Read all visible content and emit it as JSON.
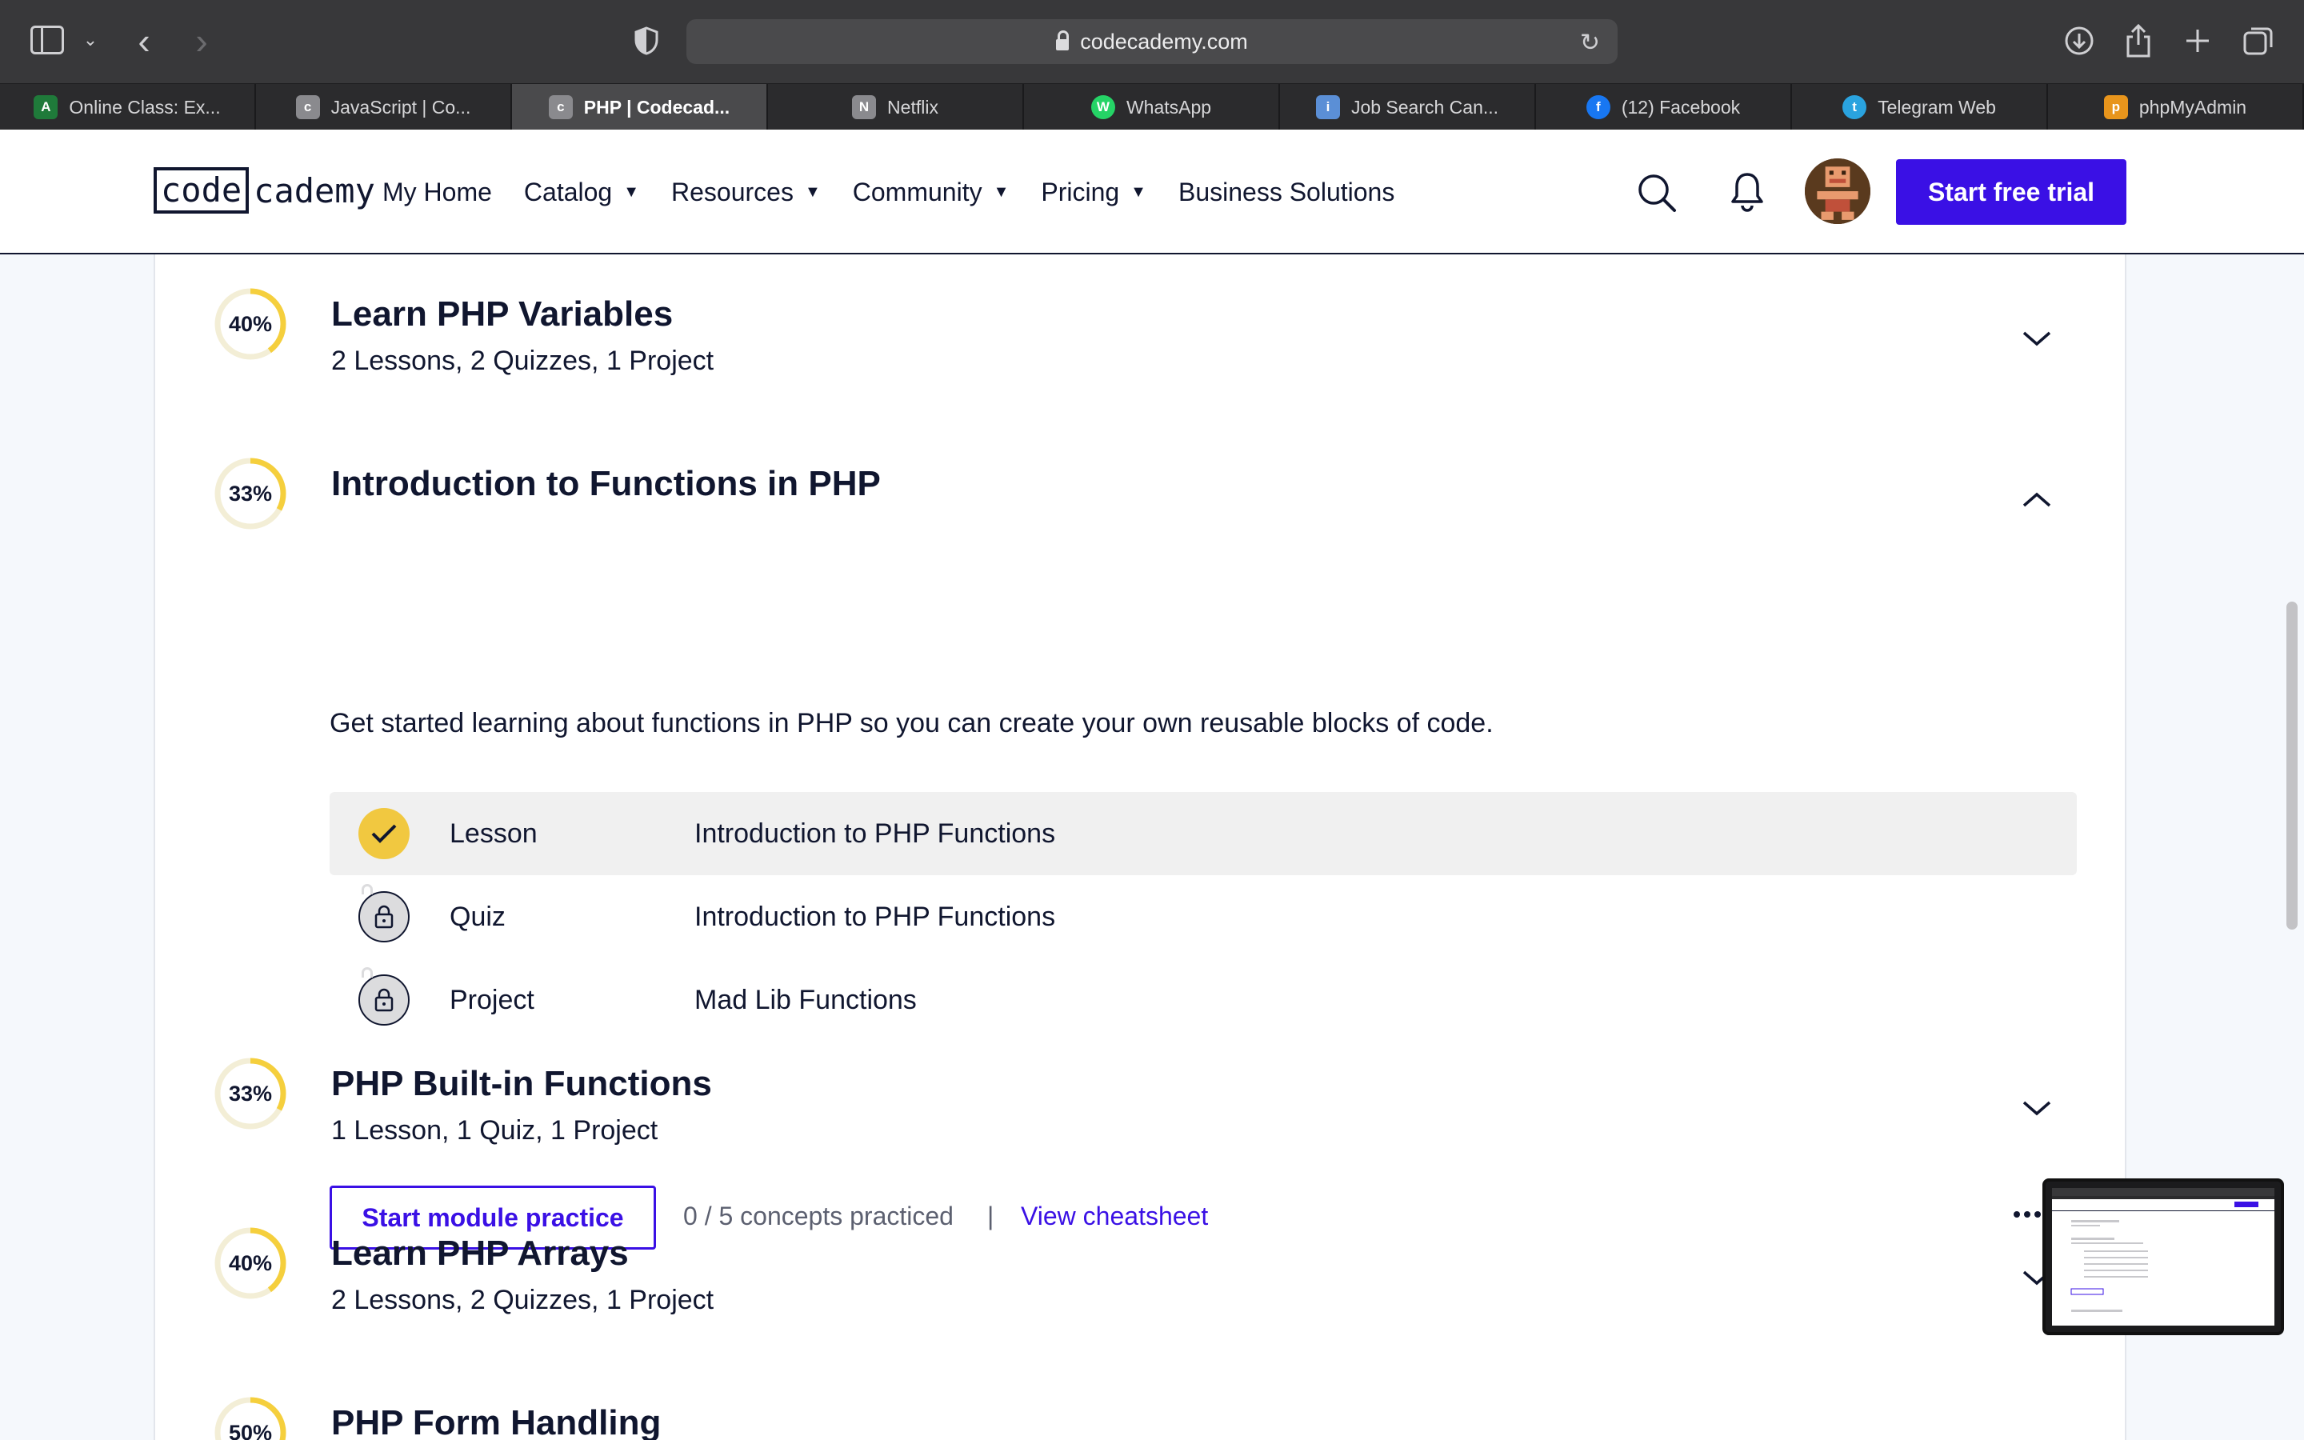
{
  "browser": {
    "url": "codecademy.com",
    "tabs": [
      {
        "title": "Online Class: Ex...",
        "favicon": "A",
        "color": "#1f7a3a",
        "active": false
      },
      {
        "title": "JavaScript | Co...",
        "favicon": "c",
        "color": "#8a8a8e",
        "active": false
      },
      {
        "title": "PHP | Codecad...",
        "favicon": "c",
        "color": "#8a8a8e",
        "active": true
      },
      {
        "title": "Netflix",
        "favicon": "N",
        "color": "#8a8a8e",
        "active": false
      },
      {
        "title": "WhatsApp",
        "favicon": "W",
        "color": "#25d366",
        "active": false
      },
      {
        "title": "Job Search Can...",
        "favicon": "i",
        "color": "#5b8fd6",
        "active": false
      },
      {
        "title": "(12) Facebook",
        "favicon": "f",
        "color": "#1877f2",
        "active": false
      },
      {
        "title": "Telegram Web",
        "favicon": "t",
        "color": "#2aa3df",
        "active": false
      },
      {
        "title": "phpMyAdmin",
        "favicon": "p",
        "color": "#e8951c",
        "active": false
      }
    ]
  },
  "header": {
    "logo_code": "code",
    "logo_cademy": "cademy",
    "nav": {
      "my_home": "My Home",
      "catalog": "Catalog",
      "resources": "Resources",
      "community": "Community",
      "pricing": "Pricing",
      "business": "Business Solutions"
    },
    "cta": "Start free trial",
    "accent_color": "#3a10e5"
  },
  "modules": [
    {
      "percent": "40%",
      "progress": 0.4,
      "title": "Learn PHP Variables",
      "subtitle": "2 Lessons, 2 Quizzes, 1 Project",
      "expanded": false
    },
    {
      "percent": "33%",
      "progress": 0.33,
      "title": "Introduction to Functions in PHP",
      "expanded": true,
      "description": "Get started learning about functions in PHP so you can create your own reusable blocks of code.",
      "items": [
        {
          "type": "Lesson",
          "name": "Introduction to PHP Functions",
          "status": "completed"
        },
        {
          "type": "Quiz",
          "name": "Introduction to PHP Functions",
          "status": "locked"
        },
        {
          "type": "Project",
          "name": "Mad Lib Functions",
          "status": "locked"
        }
      ],
      "practice_label": "Start module practice",
      "concepts_text": "0 / 5 concepts practiced",
      "separator": "|",
      "cheatsheet_label": "View cheatsheet"
    },
    {
      "percent": "33%",
      "progress": 0.33,
      "title": "PHP Built-in Functions",
      "subtitle": "1 Lesson, 1 Quiz, 1 Project",
      "expanded": false
    },
    {
      "percent": "40%",
      "progress": 0.4,
      "title": "Learn PHP Arrays",
      "subtitle": "2 Lessons, 2 Quizzes, 1 Project",
      "expanded": false
    },
    {
      "percent": "50%",
      "progress": 0.5,
      "title": "PHP Form Handling",
      "expanded": false
    }
  ],
  "colors": {
    "progress_ring": "#f5cf3d",
    "ring_track": "#f3eed6",
    "check_badge": "#f1c840"
  }
}
